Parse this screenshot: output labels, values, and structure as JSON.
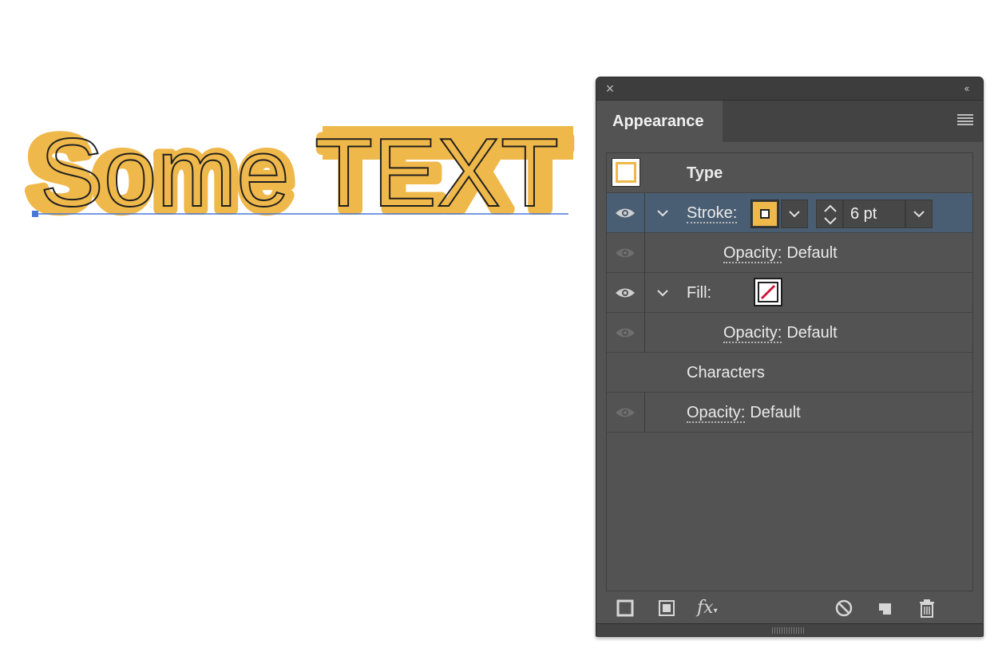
{
  "canvas": {
    "text": "Some TEXT",
    "fill_color": "#efb84a",
    "selection_color": "#4a78d8"
  },
  "panel": {
    "tab_label": "Appearance",
    "close_icon": "close-icon",
    "collapse_icon": "double-chevron-left-icon",
    "menu_icon": "panel-menu-icon",
    "selected_row_color": "#4a5e73",
    "rows": [
      {
        "label": "Type"
      },
      {
        "label": "Stroke:",
        "swatch_color": "#efb84a",
        "weight": "6 pt"
      },
      {
        "label": "Opacity:",
        "value": "Default"
      },
      {
        "label": "Fill:",
        "swatch": "none"
      },
      {
        "label": "Opacity:",
        "value": "Default"
      },
      {
        "label": "Characters"
      },
      {
        "label": "Opacity:",
        "value": "Default"
      }
    ],
    "footer_icons": [
      "add-new-stroke-icon",
      "add-new-fill-icon",
      "add-new-effect-icon",
      "clear-appearance-icon",
      "duplicate-item-icon",
      "delete-icon"
    ],
    "fx_label": "fx"
  }
}
